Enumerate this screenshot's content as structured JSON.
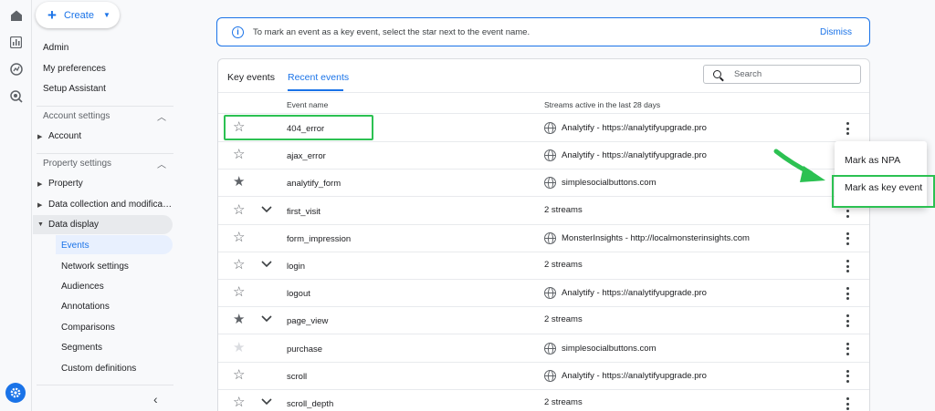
{
  "create": {
    "label": "Create"
  },
  "nav": {
    "admin": "Admin",
    "preferences": "My preferences",
    "setup": "Setup Assistant",
    "account_settings": "Account settings",
    "account": "Account",
    "property_settings": "Property settings",
    "property": "Property",
    "data_collection": "Data collection and modifica…",
    "data_display": "Data display",
    "sub_items": [
      "Events",
      "Network settings",
      "Audiences",
      "Annotations",
      "Comparisons",
      "Segments",
      "Custom definitions"
    ]
  },
  "banner": {
    "text": "To mark an event as a key event, select the star next to the event name.",
    "dismiss": "Dismiss"
  },
  "tabs": [
    "Key events",
    "Recent events"
  ],
  "search": {
    "placeholder": "Search"
  },
  "table": {
    "col_event": "Event name",
    "col_streams": "Streams active in the last 28 days",
    "rows": [
      {
        "name": "404_error",
        "stream": "Analytify - https://analytifyupgrade.pro",
        "star": "outline",
        "expand": false,
        "globe": true
      },
      {
        "name": "ajax_error",
        "stream": "Analytify - https://analytifyupgrade.pro",
        "star": "outline",
        "expand": false,
        "globe": true
      },
      {
        "name": "analytify_form",
        "stream": "simplesocialbuttons.com",
        "star": "filled",
        "expand": false,
        "globe": true
      },
      {
        "name": "first_visit",
        "stream": "2 streams",
        "star": "outline",
        "expand": true,
        "globe": false
      },
      {
        "name": "form_impression",
        "stream": "MonsterInsights - http://localmonsterinsights.com",
        "star": "outline",
        "expand": false,
        "globe": true
      },
      {
        "name": "login",
        "stream": "2 streams",
        "star": "outline",
        "expand": true,
        "globe": false
      },
      {
        "name": "logout",
        "stream": "Analytify - https://analytifyupgrade.pro",
        "star": "outline",
        "expand": false,
        "globe": true
      },
      {
        "name": "page_view",
        "stream": "2 streams",
        "star": "filled",
        "expand": true,
        "globe": false
      },
      {
        "name": "purchase",
        "stream": "simplesocialbuttons.com",
        "star": "light",
        "expand": false,
        "globe": true
      },
      {
        "name": "scroll",
        "stream": "Analytify - https://analytifyupgrade.pro",
        "star": "outline",
        "expand": false,
        "globe": true
      },
      {
        "name": "scroll_depth",
        "stream": "2 streams",
        "star": "outline",
        "expand": true,
        "globe": false
      }
    ]
  },
  "menu": {
    "npa": "Mark as NPA",
    "key_event": "Mark as key event"
  },
  "colors": {
    "accent": "#1a73e8",
    "highlight": "#2cc152"
  }
}
